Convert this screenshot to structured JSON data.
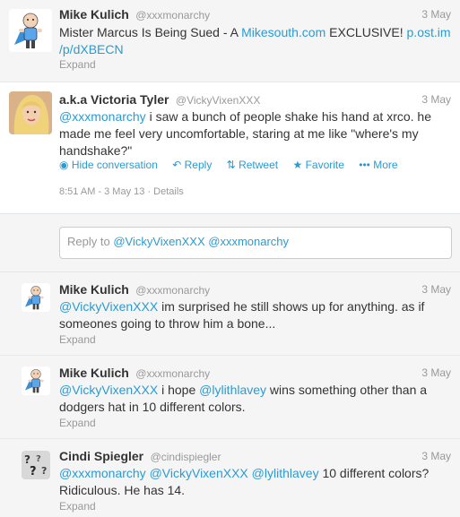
{
  "tweets": [
    {
      "name": "Mike Kulich",
      "handle": "@xxxmonarchy",
      "date": "3 May",
      "text_parts": [
        "Mister Marcus Is Being Sued - A ",
        "Mikesouth.com",
        " EXCLUSIVE! ",
        "p.ost.im",
        "/p/dXBECN"
      ],
      "expand": "Expand",
      "avatar_icon": "cartoon-superhero-avatar"
    },
    {
      "name": "a.k.a Victoria Tyler",
      "handle": "@VickyVixenXXX",
      "date": "3 May",
      "text_parts": [
        "@xxxmonarchy",
        " i saw a bunch of people shake his hand at xrco. he made me feel very uncomfortable, staring at me like \"where's my handshake?\""
      ],
      "actions": {
        "hide": "Hide conversation",
        "reply": "Reply",
        "retweet": "Retweet",
        "favorite": "Favorite",
        "more": "More"
      },
      "timestamp": "8:51 AM - 3 May 13",
      "details": "Details",
      "avatar_icon": "woman-portrait-avatar"
    },
    {
      "name": "Mike Kulich",
      "handle": "@xxxmonarchy",
      "date": "3 May",
      "text_parts": [
        "@VickyVixenXXX",
        " im surprised he still shows up for anything. as if someones going to throw him a bone..."
      ],
      "expand": "Expand",
      "avatar_icon": "cartoon-superhero-avatar"
    },
    {
      "name": "Mike Kulich",
      "handle": "@xxxmonarchy",
      "date": "3 May",
      "text_parts": [
        "@VickyVixenXXX",
        " i hope ",
        "@lylithlavey",
        " wins something other than a dodgers hat in 10 different colors."
      ],
      "expand": "Expand",
      "avatar_icon": "cartoon-superhero-avatar"
    },
    {
      "name": "Cindi Spiegler",
      "handle": "@cindispiegler",
      "date": "3 May",
      "text_parts": [
        "@xxxmonarchy",
        " ",
        "@VickyVixenXXX",
        " ",
        "@lylithlavey",
        " 10 different colors? Ridiculous. He has 14."
      ],
      "expand": "Expand",
      "avatar_icon": "question-marks-avatar"
    }
  ],
  "reply": {
    "prefix": "Reply to ",
    "mention1": "@VickyVixenXXX",
    "mention2": "@xxxmonarchy"
  },
  "colors": {
    "link": "#2a9bd1",
    "muted": "#999999",
    "text": "#333333"
  }
}
